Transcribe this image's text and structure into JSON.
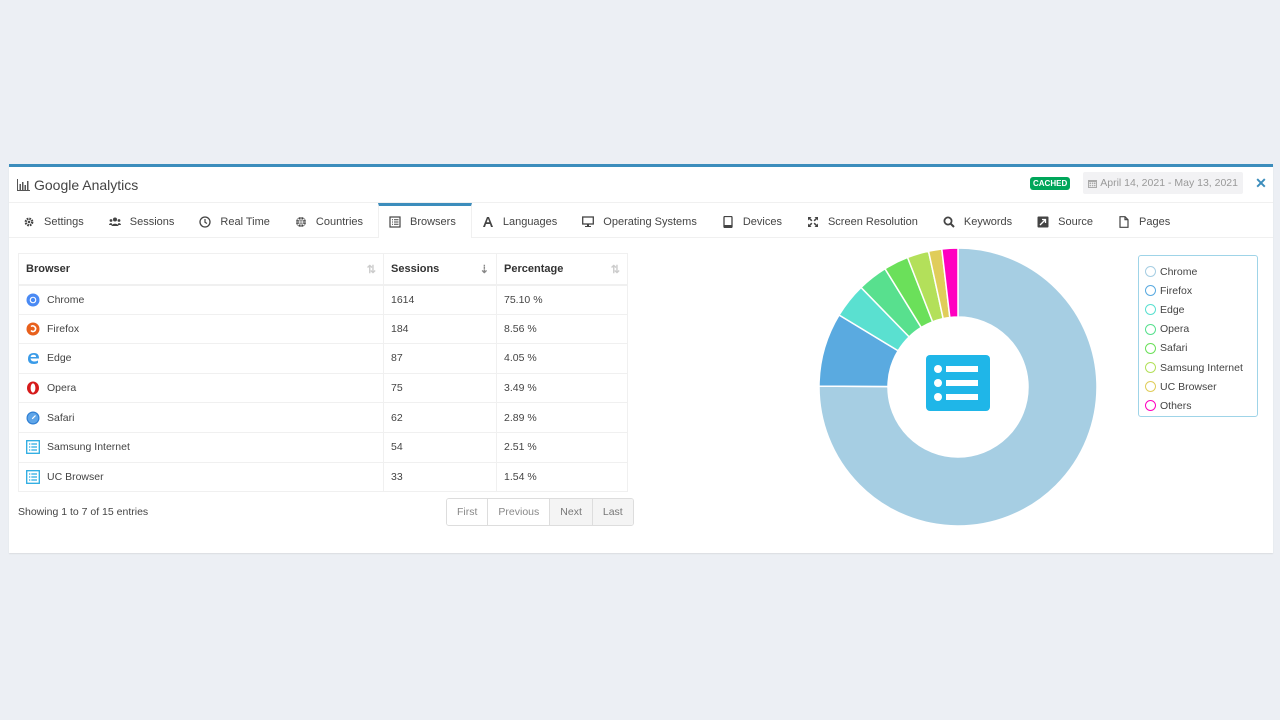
{
  "header": {
    "title": "Google Analytics",
    "title_icon": "bar-chart-icon",
    "badge": "CACHED",
    "badge_color": "#00a65a",
    "date_range": "April 14, 2021 - May 13, 2021",
    "close_label": "✕"
  },
  "tabs": [
    {
      "label": "Settings",
      "icon": "gear-icon"
    },
    {
      "label": "Sessions",
      "icon": "users-icon"
    },
    {
      "label": "Real Time",
      "icon": "clock-icon"
    },
    {
      "label": "Countries",
      "icon": "globe-icon"
    },
    {
      "label": "Browsers",
      "icon": "list-icon",
      "active": true
    },
    {
      "label": "Languages",
      "icon": "font-icon"
    },
    {
      "label": "Operating Systems",
      "icon": "desktop-icon"
    },
    {
      "label": "Devices",
      "icon": "tablet-icon"
    },
    {
      "label": "Screen Resolution",
      "icon": "expand-icon"
    },
    {
      "label": "Keywords",
      "icon": "search-icon"
    },
    {
      "label": "Source",
      "icon": "external-link-icon"
    },
    {
      "label": "Pages",
      "icon": "file-icon"
    }
  ],
  "table": {
    "columns": [
      "Browser",
      "Sessions",
      "Percentage"
    ],
    "sort_icons": [
      "sort-icon",
      "sort-amount-desc-icon",
      "sort-icon"
    ],
    "rows": [
      {
        "browser": "Chrome",
        "sessions": "1614",
        "percentage": "75.10 %",
        "icon": "chrome-icon"
      },
      {
        "browser": "Firefox",
        "sessions": "184",
        "percentage": "8.56 %",
        "icon": "firefox-icon"
      },
      {
        "browser": "Edge",
        "sessions": "87",
        "percentage": "4.05 %",
        "icon": "edge-icon"
      },
      {
        "browser": "Opera",
        "sessions": "75",
        "percentage": "3.49 %",
        "icon": "opera-icon"
      },
      {
        "browser": "Safari",
        "sessions": "62",
        "percentage": "2.89 %",
        "icon": "safari-icon"
      },
      {
        "browser": "Samsung Internet",
        "sessions": "54",
        "percentage": "2.51 %",
        "icon": "list-alt-icon"
      },
      {
        "browser": "UC Browser",
        "sessions": "33",
        "percentage": "1.54 %",
        "icon": "list-alt-icon"
      }
    ],
    "showing": "Showing 1 to 7 of 15 entries",
    "pagination": [
      "First",
      "Previous",
      "Next",
      "Last"
    ]
  },
  "chart_data": {
    "type": "pie",
    "title": "",
    "center_icon": "list-alt-icon",
    "legend_position": "right",
    "categories": [
      "Chrome",
      "Firefox",
      "Edge",
      "Opera",
      "Safari",
      "Samsung Internet",
      "UC Browser",
      "Others"
    ],
    "values": [
      75.1,
      8.56,
      4.05,
      3.49,
      2.89,
      2.51,
      1.54,
      1.86
    ],
    "colors": [
      "#a6cee3",
      "#5aaae0",
      "#5ae0d0",
      "#58e08e",
      "#6be05a",
      "#b3e05a",
      "#e0cd5a",
      "#ff00c0"
    ]
  }
}
